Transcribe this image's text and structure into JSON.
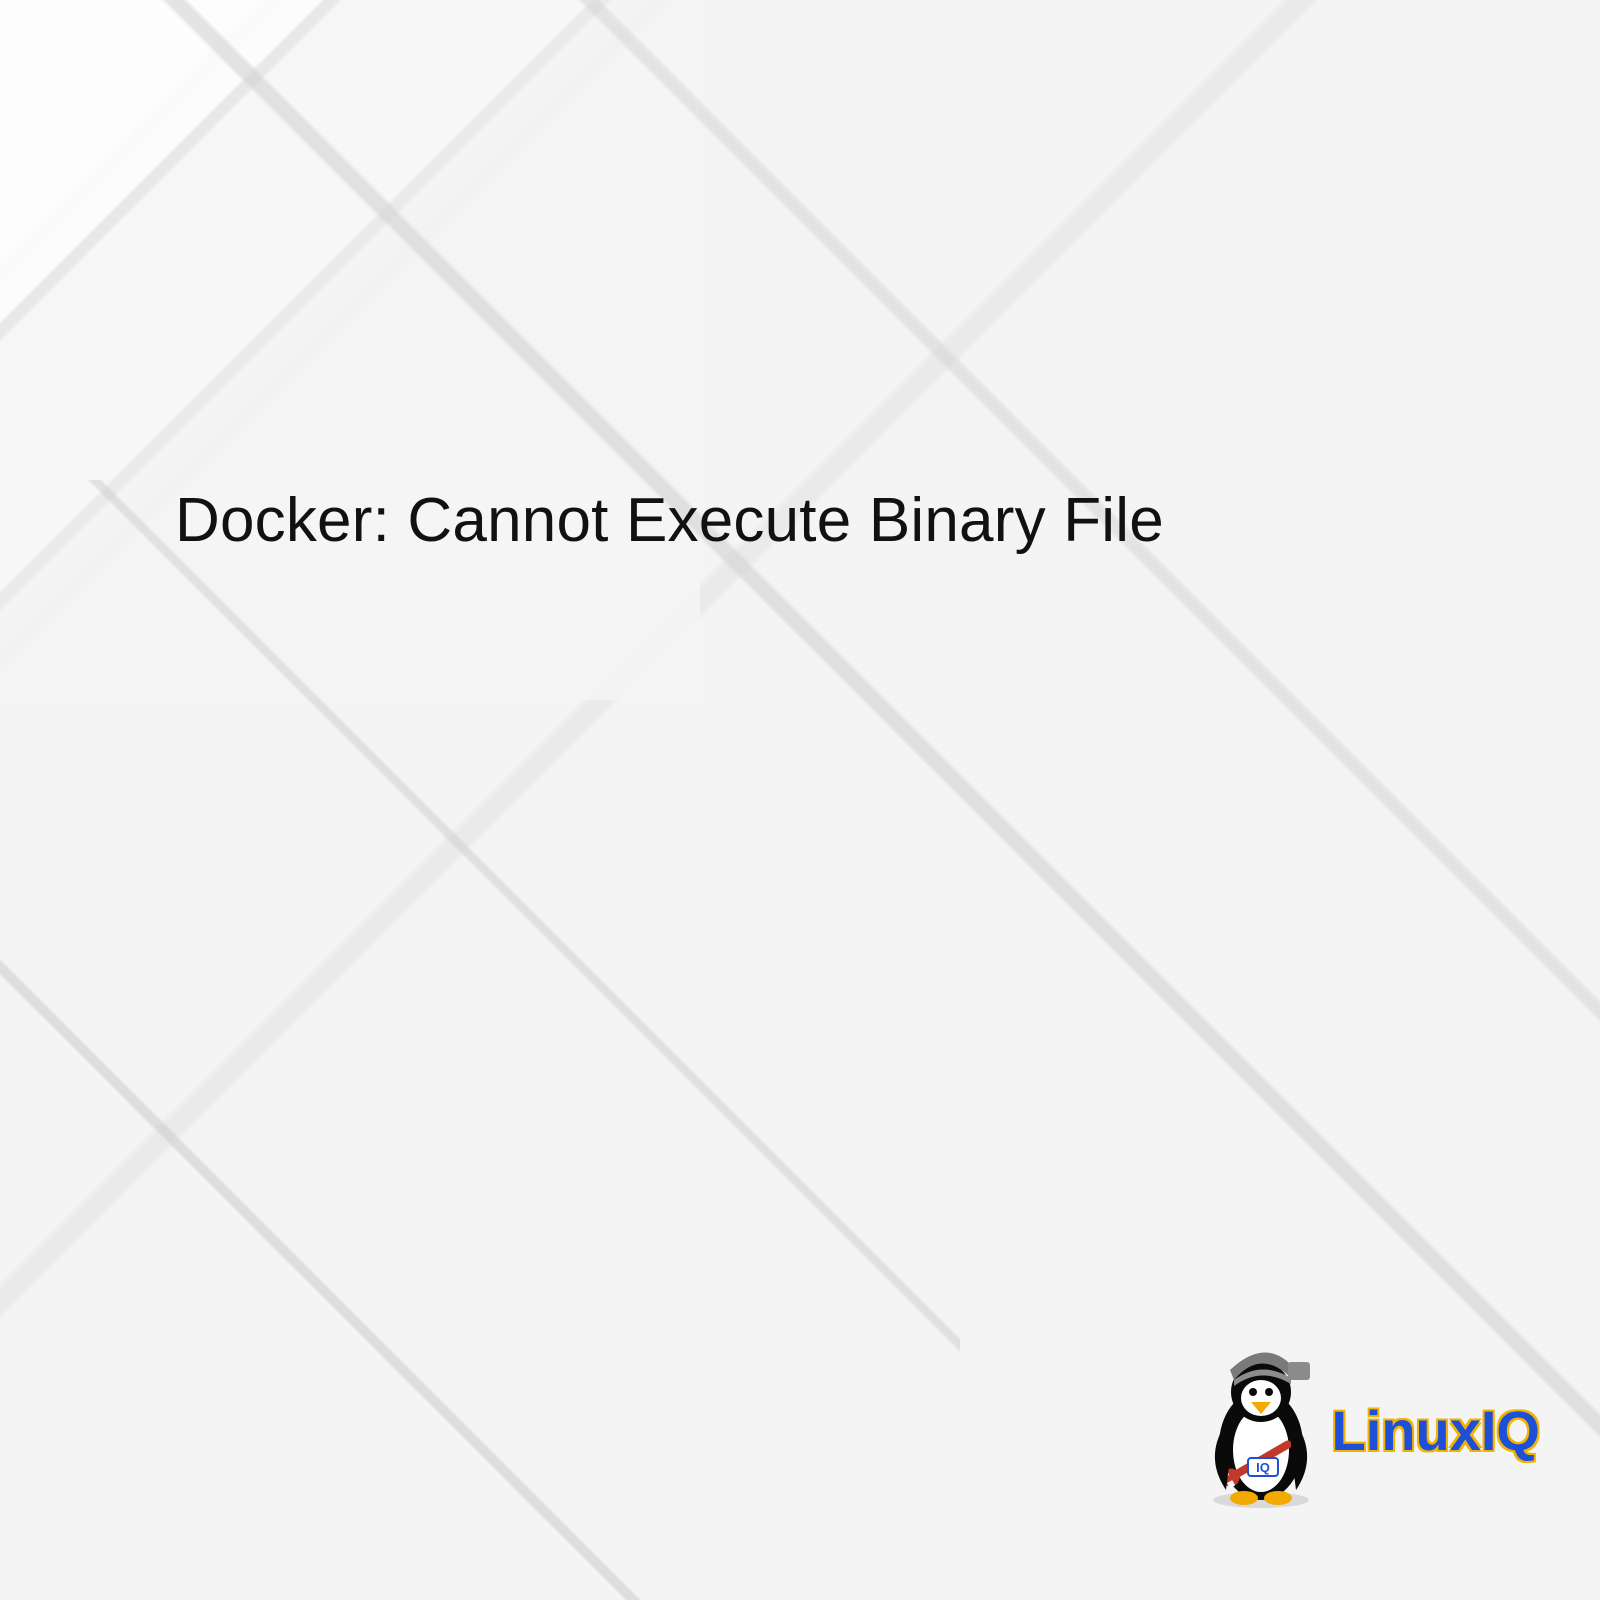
{
  "title": "Docker: Cannot Execute Binary File",
  "logo": {
    "text": "LinuxIQ",
    "badge": "IQ"
  },
  "colors": {
    "logo_text": "#1e4fd8",
    "logo_outline": "#f2b200",
    "penguin_body": "#0a0a0a",
    "penguin_belly": "#ffffff",
    "penguin_beak": "#f2a900",
    "penguin_cap": "#7a7a7a",
    "penguin_wrench": "#c0392b"
  }
}
